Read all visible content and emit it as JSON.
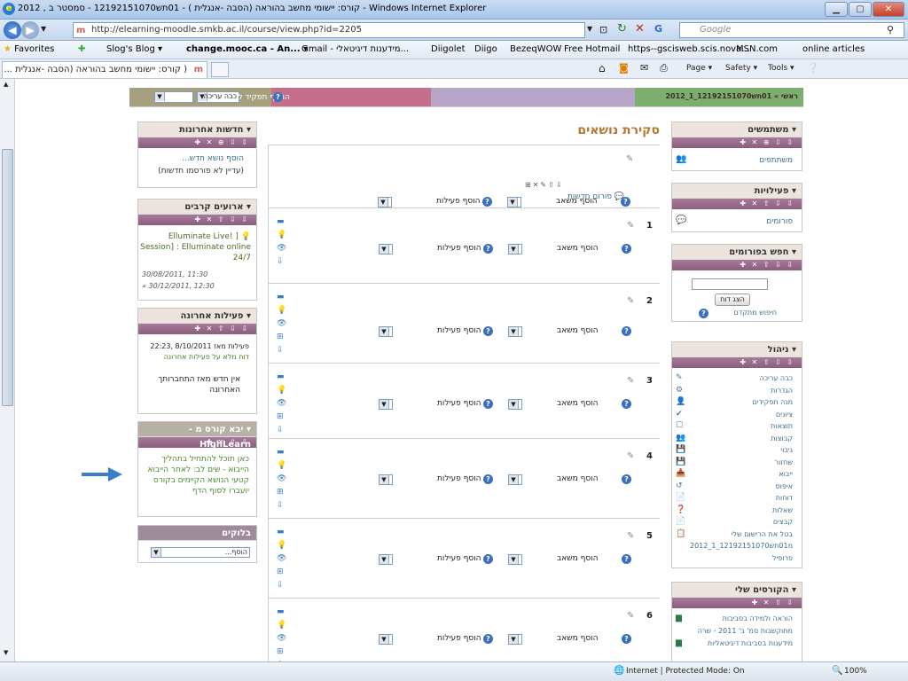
{
  "browser": {
    "window_title": "קורס: יישומי מחשב בהוראה (הסבה -אנגלית ) - 01תש12192151070 - סמסטר ב , 2012 - Windows Internet Explorer",
    "address": "http://elearning-moodle.smkb.ac.il/course/view.php?id=2205",
    "search_placeholder": "Google",
    "favorites_label": "Favorites",
    "favorites": [
      "Slog's Blog ▾",
      "change.mooc.ca - An... ▾",
      "Gmail - מידענות דיגיטאלי...",
      "Diigolet",
      "Diigo",
      "BezeqWOW",
      "Free Hotmail",
      "https--gscisweb.scis.nova...",
      "MSN.com",
      "online articles"
    ],
    "tab_title": "( קורס: יישומי מחשב בהוראה (הסבה -אנגלית ...",
    "toolbar": {
      "page": "Page ▾",
      "safety": "Safety ▾",
      "tools": "Tools ▾"
    },
    "status": {
      "zone": "Internet | Protected Mode: On",
      "zoom": "100%"
    }
  },
  "moodle": {
    "breadcrumb": "ראשי » 01תש12192151070_1_2012",
    "edit_select": "כבה עריכה",
    "role_switch": "החלף תפקיד ל...",
    "topics_title": "סקירת נושאים",
    "news_forum": "פורום חדשות",
    "add_resource": "הוסף משאב",
    "add_activity": "הוסף פעילות",
    "section_numbers": [
      "1",
      "2",
      "3",
      "4",
      "5",
      "6"
    ],
    "right": {
      "users_title": "משתתפים",
      "users_heading": "משתמשים",
      "activities_heading": "פעילויות",
      "forums_link": "פורומים",
      "search_heading": "חפש בפורומים",
      "search_button": "הצג דוח",
      "advanced_search": "חיפוש מתקדם",
      "admin_heading": "ניהול",
      "admin_items": [
        "כבה עריכה",
        "הגדרות",
        "מנה תפקידים",
        "ציונים",
        "תוצאות",
        "קבוצות",
        "גיבוי",
        "שחזור",
        "ייבוא",
        "איפוס",
        "דוחות",
        "שאלות",
        "קבצים",
        "בטל את הרישום שלי",
        "מ01תש12192151070_1_2012",
        "פרופיל"
      ],
      "courses_heading": "הקורסים שלי",
      "courses": [
        "הוראה ולמידה בסביבות",
        "מתוקשבות סמ' ב' 2011 - שרה",
        "מידענות בסביבות דיגיטאליות"
      ]
    },
    "left": {
      "news_heading": "חדשות אחרונות",
      "news_add": "הוסף נושא חדש...",
      "news_empty": "(עדיין לא פורסמו חדשות)",
      "events_heading": "ארועים קרבים",
      "event_title": "Elluminate Live! ] Session] : Elluminate online 24/7",
      "event_from": "30/08/2011, 11:30",
      "event_to": "» 30/12/2011, 12:30",
      "recent_heading": "פעילות אחרונה",
      "recent_since": "פעילות מאז 8/10/2011 ,22:23",
      "recent_report": "דוח מלא על פעילות אחרונה",
      "recent_none": "אין חדש מאז התחברותך האחרונה",
      "highlearn_heading": "יבא קורס מ - HighLearn",
      "highlearn_text": "כאן תוכל להתחיל בתהליך הייבוא - שים לב: לאחר הייבוא קטעי הנושא הקיימים בקורס יועברו לסוף הדף",
      "blocks_heading": "בלוקים",
      "blocks_add": "הוסף..."
    }
  },
  "colors": {
    "bar1": "#a7a07e",
    "bar2": "#c5708a",
    "bar3": "#b7a5c7",
    "bar4": "#7cae6f",
    "arrow": "#3b7dc6",
    "link": "#3a6e8c"
  }
}
